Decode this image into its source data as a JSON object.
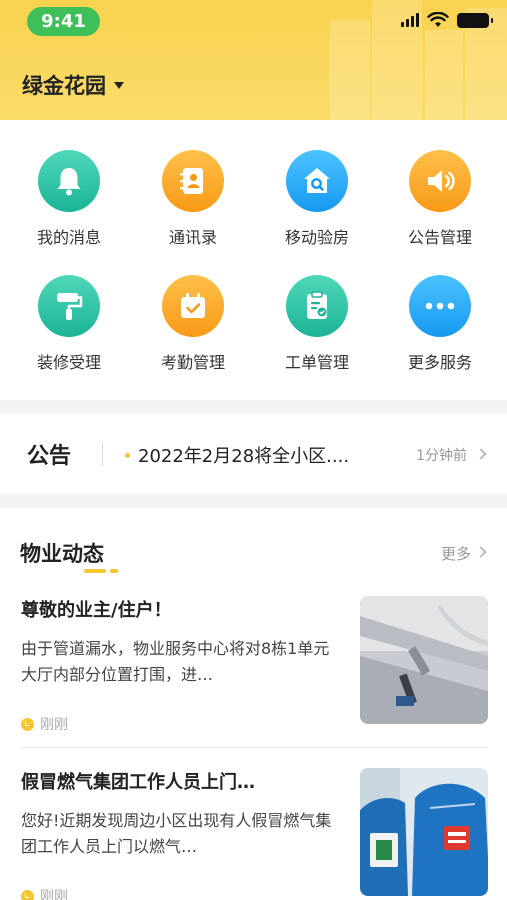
{
  "status_bar": {
    "time": "9:41"
  },
  "header": {
    "community_name": "绿金花园"
  },
  "grid": [
    {
      "label": "我的消息",
      "icon": "bell-icon",
      "color": "teal"
    },
    {
      "label": "通讯录",
      "icon": "contacts-icon",
      "color": "orange"
    },
    {
      "label": "移动验房",
      "icon": "house-search-icon",
      "color": "blue"
    },
    {
      "label": "公告管理",
      "icon": "speaker-icon",
      "color": "orange"
    },
    {
      "label": "装修受理",
      "icon": "paint-roller-icon",
      "color": "teal"
    },
    {
      "label": "考勤管理",
      "icon": "calendar-check-icon",
      "color": "orange"
    },
    {
      "label": "工单管理",
      "icon": "clipboard-icon",
      "color": "teal"
    },
    {
      "label": "更多服务",
      "icon": "more-dots-icon",
      "color": "blue"
    }
  ],
  "notice": {
    "title": "公告",
    "text": "2022年2月28将全小区....",
    "time": "1分钟前"
  },
  "news": {
    "title": "物业动态",
    "more_label": "更多",
    "articles": [
      {
        "title": "尊敬的业主/住户！",
        "body": "由于管道漏水，物业服务中心将对8栋1单元大厅内部分位置打围，进…",
        "time": "刚刚"
      },
      {
        "title": "假冒燃气集团工作人员上门…",
        "body": "您好!近期发现周边小区出现有人假冒燃气集团工作人员上门以燃气…",
        "time": "刚刚"
      }
    ]
  },
  "colors": {
    "header_yellow": "#f9d34f",
    "accent_yellow": "#f7c531",
    "teal": "#1cb496",
    "orange": "#f79a16",
    "blue": "#1699f0"
  }
}
